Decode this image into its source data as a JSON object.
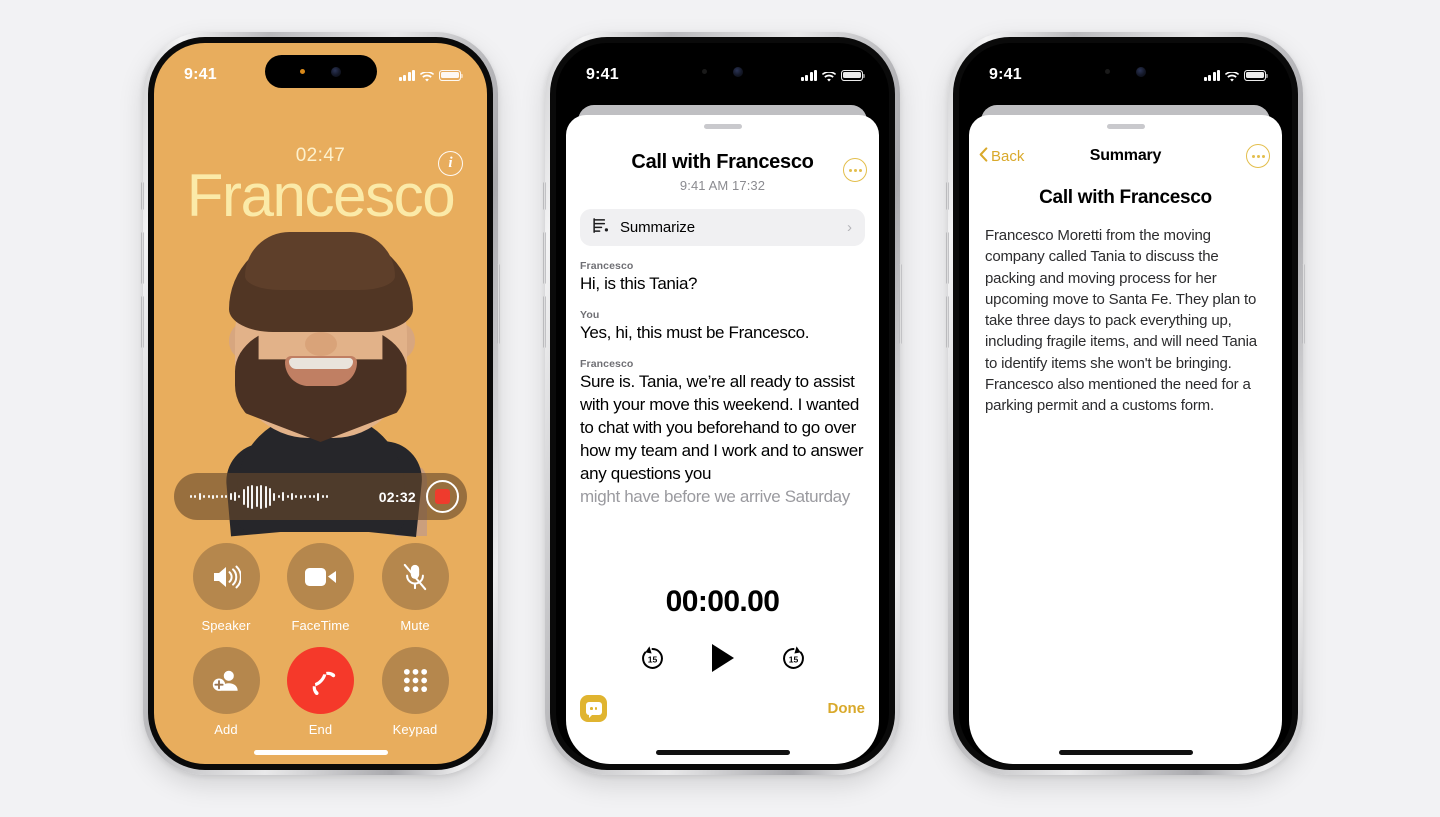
{
  "background_color": "#f2f2f4",
  "phone1": {
    "name": "call-screen",
    "accent_color": "#e8ad5d",
    "status_bar": {
      "time": "9:41",
      "signal": "signal-bars-icon",
      "wifi": "wifi-icon",
      "battery": "battery-icon"
    },
    "info_button": "i",
    "call_duration": "02:47",
    "caller_name": "Francesco",
    "recording": {
      "time": "02:32",
      "button": "record-stop-button"
    },
    "controls": [
      {
        "label": "Speaker",
        "icon": "speaker-icon"
      },
      {
        "label": "FaceTime",
        "icon": "video-camera-icon"
      },
      {
        "label": "Mute",
        "icon": "microphone-muted-icon"
      },
      {
        "label": "Add",
        "icon": "add-person-icon"
      },
      {
        "label": "End",
        "icon": "end-call-icon"
      },
      {
        "label": "Keypad",
        "icon": "keypad-icon"
      }
    ]
  },
  "phone2": {
    "name": "call-recording-sheet",
    "status_bar": {
      "time": "9:41",
      "signal": "signal-bars-icon",
      "wifi": "wifi-icon",
      "battery": "battery-icon"
    },
    "title": "Call with Francesco",
    "subtitle": "9:41 AM  17:32",
    "more_button": "ellipsis-button",
    "summarize": {
      "label": "Summarize",
      "icon": "text-lines-icon",
      "chevron": "chevron-right-icon"
    },
    "transcript": [
      {
        "speaker": "Francesco",
        "text": "Hi, is this Tania?",
        "faded": false
      },
      {
        "speaker": "You",
        "text": "Yes, hi, this must be Francesco.",
        "faded": false
      },
      {
        "speaker": "Francesco",
        "text": "Sure is. Tania, we’re all ready to assist with your move this weekend. I wanted to chat with you beforehand to go over how my team and I work and to answer any questions you",
        "faded": false
      },
      {
        "speaker": "",
        "text": "might have before we arrive Saturday",
        "faded": true
      }
    ],
    "player": {
      "time": "00:00.00",
      "skip_back_label": "15",
      "skip_forward_label": "15",
      "play_button": "play-icon"
    },
    "footer": {
      "transcript_button": "transcript-bubble-icon",
      "done_label": "Done"
    }
  },
  "phone3": {
    "name": "summary-screen",
    "status_bar": {
      "time": "9:41",
      "signal": "signal-bars-icon",
      "wifi": "wifi-icon",
      "battery": "battery-icon"
    },
    "back_label": "Back",
    "nav_title": "Summary",
    "more_button": "ellipsis-button",
    "summary_title": "Call with Francesco",
    "summary_body": "Francesco Moretti from the moving company called Tania to discuss the packing and moving process for her upcoming move to Santa Fe. They plan to take three days to pack everything up, including fragile items, and will need Tania to identify items she won't be bringing. Francesco also mentioned the need for a parking permit and a customs form."
  }
}
